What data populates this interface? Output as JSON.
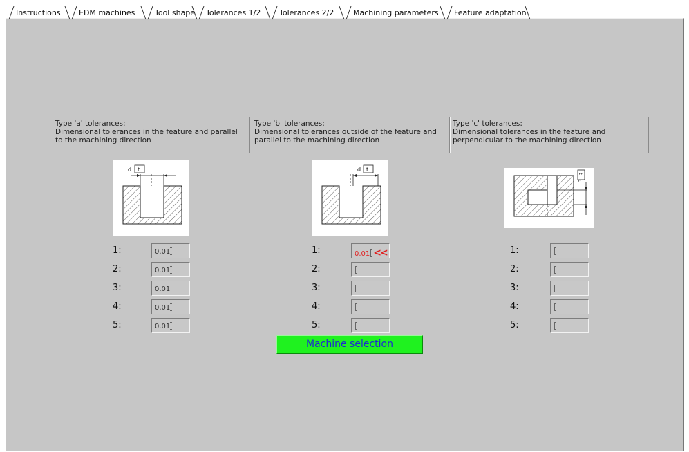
{
  "tabs": [
    {
      "label": "Instructions"
    },
    {
      "label": "EDM machines"
    },
    {
      "label": "Tool shape"
    },
    {
      "label": "Tolerances 1/2"
    },
    {
      "label": "Tolerances 2/2"
    },
    {
      "label": "Machining parameters"
    },
    {
      "label": "Feature adaptation"
    }
  ],
  "active_tab": "Tolerances 1/2",
  "columns": [
    {
      "description": "Type 'a' tolerances:\nDimensional tolerances in the feature and parallel\nto the machining direction",
      "rows": [
        {
          "label": "1:",
          "value": "0.01"
        },
        {
          "label": "2:",
          "value": "0.01"
        },
        {
          "label": "3:",
          "value": "0.01"
        },
        {
          "label": "4:",
          "value": "0.01"
        },
        {
          "label": "5:",
          "value": "0.01"
        }
      ]
    },
    {
      "description": "Type 'b' tolerances:\nDimensional tolerances outside of the feature and\nparallel to the machining direction",
      "rows": [
        {
          "label": "1:",
          "value": "0.01",
          "marker": "<<"
        },
        {
          "label": "2:",
          "value": ""
        },
        {
          "label": "3:",
          "value": ""
        },
        {
          "label": "4:",
          "value": ""
        },
        {
          "label": "5:",
          "value": ""
        }
      ]
    },
    {
      "description": "Type 'c' tolerances:\nDimensional tolerances in the feature and\nperpendicular to the machining direction",
      "rows": [
        {
          "label": "1:",
          "value": ""
        },
        {
          "label": "2:",
          "value": ""
        },
        {
          "label": "3:",
          "value": ""
        },
        {
          "label": "4:",
          "value": ""
        },
        {
          "label": "5:",
          "value": ""
        }
      ]
    }
  ],
  "diagram_labels": {
    "d": "d",
    "t": "t"
  },
  "button": {
    "label": "Machine selection"
  },
  "colors": {
    "panel": "#c6c6c6",
    "button": "#1ff21f",
    "button_text": "#1c2bd0",
    "error": "#e02020"
  }
}
